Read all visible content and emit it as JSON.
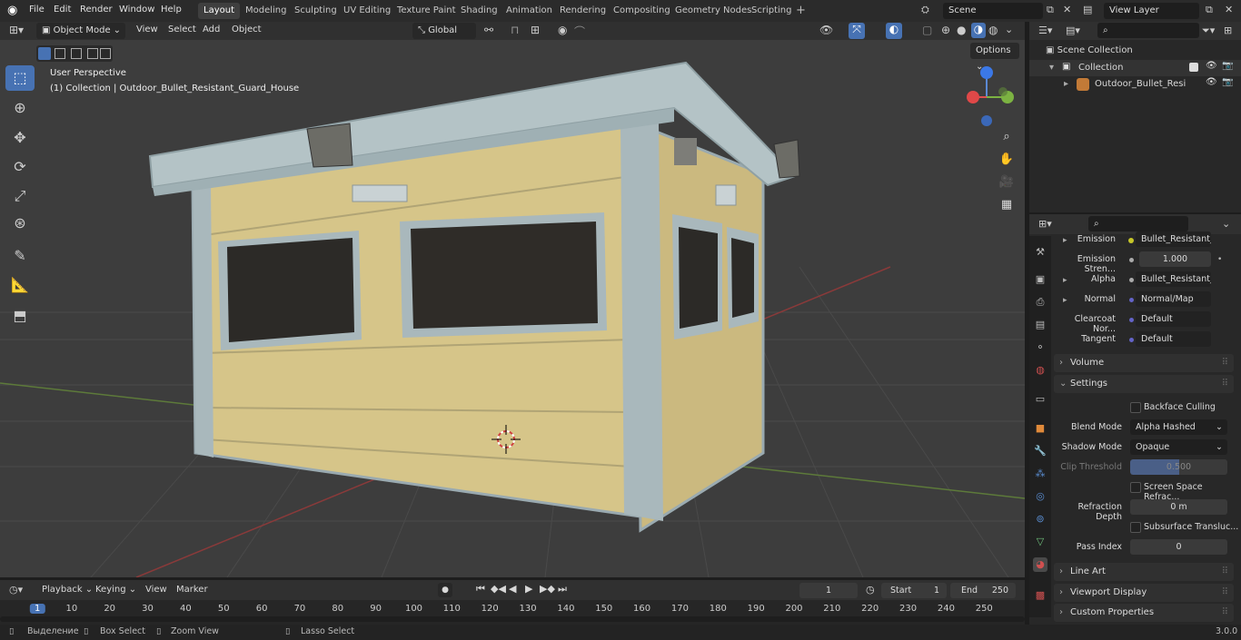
{
  "topbar": {
    "menus": [
      "File",
      "Edit",
      "Render",
      "Window",
      "Help"
    ],
    "workspaces": [
      "Layout",
      "Modeling",
      "Sculpting",
      "UV Editing",
      "Texture Paint",
      "Shading",
      "Animation",
      "Rendering",
      "Compositing",
      "Geometry Nodes",
      "Scripting"
    ],
    "active_workspace": "Layout",
    "scene": "Scene",
    "view_layer": "View Layer"
  },
  "viewport_header": {
    "mode": "Object Mode",
    "menus": [
      "View",
      "Select",
      "Add",
      "Object"
    ],
    "transform_orientation": "Global",
    "options_label": "Options"
  },
  "viewport": {
    "view_name": "User Perspective",
    "collection_info": "(1) Collection | Outdoor_Bullet_Resistant_Guard_House",
    "gizmo": {
      "x": "X",
      "y": "Y",
      "z": "Z"
    }
  },
  "outliner": {
    "scene_collection": "Scene Collection",
    "collection": "Collection",
    "object": "Outdoor_Bullet_Resistan"
  },
  "properties": {
    "rows": [
      {
        "label": "Emission",
        "value": "Bullet_Resistant_..."
      },
      {
        "label": "Emission Stren...",
        "value": "1.000"
      },
      {
        "label": "Alpha",
        "value": "Bullet_Resistant_..."
      },
      {
        "label": "Normal",
        "value": "Normal/Map"
      },
      {
        "label": "Clearcoat Nor...",
        "value": "Default"
      },
      {
        "label": "Tangent",
        "value": "Default"
      }
    ],
    "volume": "Volume",
    "settings": "Settings",
    "backface_culling": "Backface Culling",
    "blend_mode_label": "Blend Mode",
    "blend_mode": "Alpha Hashed",
    "shadow_mode_label": "Shadow Mode",
    "shadow_mode": "Opaque",
    "clip_threshold_label": "Clip Threshold",
    "clip_threshold": "0.500",
    "clip_threshold_fraction": 0.5,
    "screen_space_refraction": "Screen Space Refrac...",
    "refraction_depth_label": "Refraction Depth",
    "refraction_depth": "0 m",
    "subsurface_translucency": "Subsurface Transluc...",
    "pass_index_label": "Pass Index",
    "pass_index": "0",
    "line_art": "Line Art",
    "viewport_display": "Viewport Display",
    "custom_properties": "Custom Properties"
  },
  "timeline": {
    "menus": [
      "Playback",
      "Keying",
      "View",
      "Marker"
    ],
    "current_frame": "1",
    "start_label": "Start",
    "start": "1",
    "end_label": "End",
    "end": "250",
    "ruler": [
      "1",
      "10",
      "20",
      "30",
      "40",
      "50",
      "60",
      "70",
      "80",
      "90",
      "100",
      "110",
      "120",
      "130",
      "140",
      "150",
      "160",
      "170",
      "180",
      "190",
      "200",
      "210",
      "220",
      "230",
      "240",
      "250"
    ]
  },
  "statusbar": {
    "select": "Выделение",
    "box_select": "Box Select",
    "zoom_view": "Zoom View",
    "lasso_select": "Lasso Select",
    "version": "3.0.0"
  }
}
